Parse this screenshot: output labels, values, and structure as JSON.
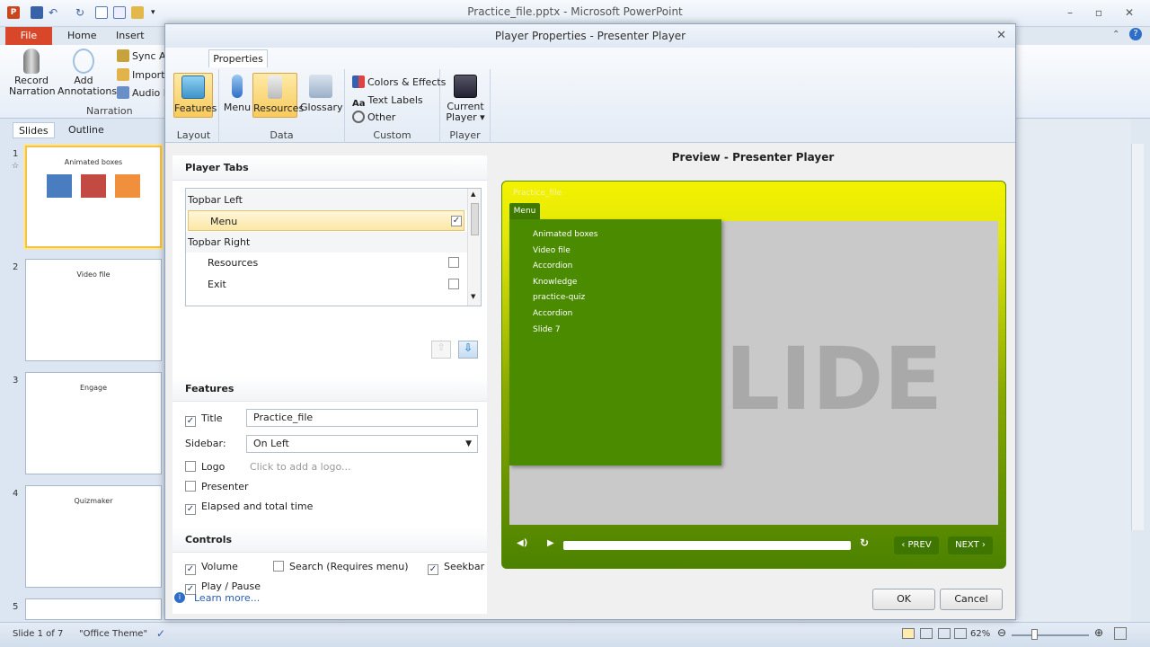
{
  "app": {
    "title": "Practice_file.pptx - Microsoft PowerPoint",
    "file_tab": "File",
    "tabs": [
      "Home",
      "Insert"
    ]
  },
  "ppt_ribbon": {
    "record_narration": "Record Narration",
    "add_annotations": "Add Annotations",
    "sync_animations": "Sync Ani",
    "import": "Import",
    "audio": "Audio E",
    "group_label": "Narration"
  },
  "slides_pane": {
    "tabs": [
      "Slides",
      "Outline"
    ],
    "slides": [
      {
        "num": "1",
        "title": "Animated boxes"
      },
      {
        "num": "2",
        "title": "Video file"
      },
      {
        "num": "3",
        "title": "Engage"
      },
      {
        "num": "4",
        "title": "Quizmaker"
      },
      {
        "num": "5",
        "title": ""
      }
    ]
  },
  "status": {
    "slide_of": "Slide 1 of 7",
    "theme": "\"Office Theme\"",
    "zoom": "62%"
  },
  "dialog": {
    "title": "Player Properties - Presenter Player",
    "ribbon_tab": "Properties",
    "groups": {
      "layout": {
        "label": "Layout",
        "features": "Features"
      },
      "data": {
        "label": "Data",
        "menu": "Menu",
        "resources": "Resources",
        "glossary": "Glossary"
      },
      "custom": {
        "label": "Custom",
        "colors": "Colors & Effects",
        "text_labels": "Text Labels",
        "other": "Other"
      },
      "player": {
        "label": "Player",
        "current_line1": "Current",
        "current_line2": "Player ▾"
      }
    },
    "player_tabs": {
      "header": "Player Tabs",
      "items": [
        {
          "type": "group",
          "label": "Topbar Left"
        },
        {
          "type": "item",
          "label": "Menu",
          "checked": true,
          "selected": true
        },
        {
          "type": "group",
          "label": "Topbar Right"
        },
        {
          "type": "item",
          "label": "Resources",
          "checked": false
        },
        {
          "type": "item",
          "label": "Exit",
          "checked": false
        }
      ]
    },
    "features": {
      "header": "Features",
      "title_label": "Title",
      "title_checked": "✓",
      "title_value": "Practice_file",
      "sidebar_label": "Sidebar:",
      "sidebar_value": "On Left",
      "logo_label": "Logo",
      "logo_placeholder": "Click to add a logo...",
      "presenter_label": "Presenter",
      "elapsed_label": "Elapsed and total time",
      "elapsed_checked": "✓"
    },
    "controls": {
      "header": "Controls",
      "volume": "Volume",
      "search": "Search (Requires menu)",
      "seekbar": "Seekbar",
      "play_pause": "Play / Pause",
      "check": "✓"
    },
    "learn_more": "Learn more...",
    "ok": "OK",
    "cancel": "Cancel",
    "preview": {
      "title": "Preview - Presenter Player",
      "player_title": "Practice_file",
      "menu_tab": "Menu",
      "menu_items": [
        "Animated boxes",
        "Video file",
        "Accordion",
        "Knowledge",
        "practice-quiz",
        "Accordion",
        "Slide 7"
      ],
      "slide_text": "LIDE",
      "prev": "PREV",
      "next": "NEXT"
    }
  },
  "colors": {
    "accent_yellow": "#f3f200",
    "player_green": "#4a8b00",
    "file_tab": "#d9472b"
  }
}
